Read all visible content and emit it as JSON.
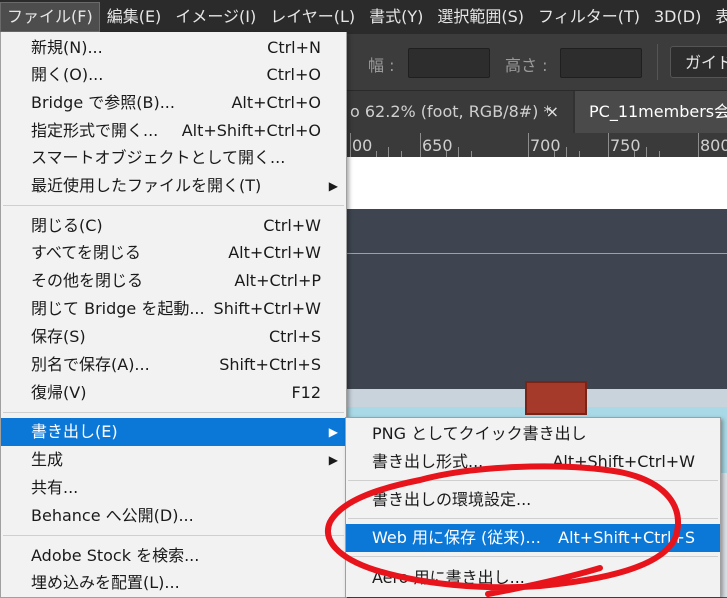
{
  "menubar": {
    "items": [
      "ファイル(F)",
      "編集(E)",
      "イメージ(I)",
      "レイヤー(L)",
      "書式(Y)",
      "選択範囲(S)",
      "フィルター(T)",
      "3D(D)",
      "表示"
    ]
  },
  "options_bar": {
    "width_label": "幅 :",
    "height_label": "高さ :",
    "guide_button": "ガイド"
  },
  "tabs": [
    {
      "label": "o 62.2% (foot, RGB/8#) *",
      "close": "×"
    },
    {
      "label": "PC_11members会"
    }
  ],
  "ruler": {
    "labels": [
      "00",
      "650",
      "700",
      "750",
      "800"
    ]
  },
  "file_menu": {
    "items": [
      {
        "label": "新規(N)...",
        "shortcut": "Ctrl+N"
      },
      {
        "label": "開く(O)...",
        "shortcut": "Ctrl+O"
      },
      {
        "label": "Bridge で参照(B)...",
        "shortcut": "Alt+Ctrl+O"
      },
      {
        "label": "指定形式で開く...",
        "shortcut": "Alt+Shift+Ctrl+O"
      },
      {
        "label": "スマートオブジェクトとして開く...",
        "shortcut": ""
      },
      {
        "label": "最近使用したファイルを開く(T)",
        "shortcut": "",
        "submenu": true
      },
      {
        "label": "閉じる(C)",
        "shortcut": "Ctrl+W"
      },
      {
        "label": "すべてを閉じる",
        "shortcut": "Alt+Ctrl+W"
      },
      {
        "label": "その他を閉じる",
        "shortcut": "Alt+Ctrl+P"
      },
      {
        "label": "閉じて Bridge を起動...",
        "shortcut": "Shift+Ctrl+W"
      },
      {
        "label": "保存(S)",
        "shortcut": "Ctrl+S"
      },
      {
        "label": "別名で保存(A)...",
        "shortcut": "Shift+Ctrl+S"
      },
      {
        "label": "復帰(V)",
        "shortcut": "F12"
      },
      {
        "label": "書き出し(E)",
        "shortcut": "",
        "submenu": true,
        "highlighted": true
      },
      {
        "label": "生成",
        "shortcut": "",
        "submenu": true
      },
      {
        "label": "共有...",
        "shortcut": ""
      },
      {
        "label": "Behance へ公開(D)...",
        "shortcut": ""
      },
      {
        "label": "Adobe Stock を検索...",
        "shortcut": ""
      },
      {
        "label": "埋め込みを配置(L)...",
        "shortcut": ""
      }
    ]
  },
  "export_submenu": {
    "items": [
      {
        "label": "PNG としてクイック書き出し",
        "shortcut": ""
      },
      {
        "label": "書き出し形式...",
        "shortcut": "Alt+Shift+Ctrl+W"
      },
      {
        "label": "書き出しの環境設定...",
        "shortcut": ""
      },
      {
        "label": "Web 用に保存 (従来)...",
        "shortcut": "Alt+Shift+Ctrl+S",
        "highlighted": true
      },
      {
        "label": "Aero 用に書き出し...",
        "shortcut": ""
      }
    ]
  },
  "colors": {
    "highlight": "#0b78d8",
    "annotation": "#e8141c",
    "guide": "#35c4ff"
  }
}
